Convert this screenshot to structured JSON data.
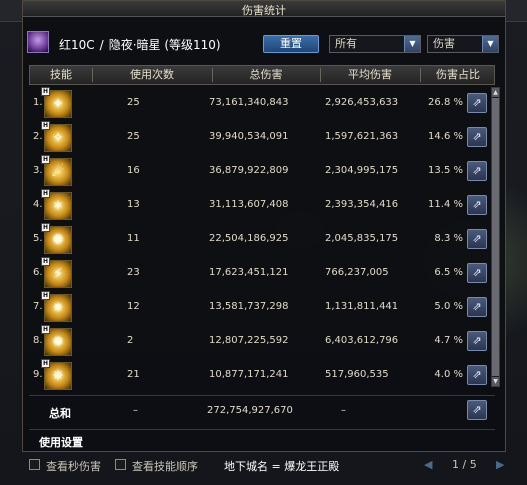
{
  "window": {
    "title": "伤害统计"
  },
  "character": {
    "name": "红10C",
    "class_level": "隐夜·暗星 (等级110)"
  },
  "controls": {
    "reset_label": "重置",
    "filter_all": "所有",
    "filter_type": "伤害"
  },
  "table": {
    "headers": [
      "技能",
      "使用次数",
      "总伤害",
      "平均伤害",
      "伤害占比"
    ],
    "rows": [
      {
        "no": "1.",
        "uses": "25",
        "total": "73,161,340,843",
        "avg": "2,926,453,633",
        "pct": "26.8 %"
      },
      {
        "no": "2.",
        "uses": "25",
        "total": "39,940,534,091",
        "avg": "1,597,621,363",
        "pct": "14.6 %"
      },
      {
        "no": "3.",
        "uses": "16",
        "total": "36,879,922,809",
        "avg": "2,304,995,175",
        "pct": "13.5 %"
      },
      {
        "no": "4.",
        "uses": "13",
        "total": "31,113,607,408",
        "avg": "2,393,354,416",
        "pct": "11.4 %"
      },
      {
        "no": "5.",
        "uses": "11",
        "total": "22,504,186,925",
        "avg": "2,045,835,175",
        "pct": "8.3 %"
      },
      {
        "no": "6.",
        "uses": "23",
        "total": "17,623,451,121",
        "avg": "766,237,005",
        "pct": "6.5 %"
      },
      {
        "no": "7.",
        "uses": "12",
        "total": "13,581,737,298",
        "avg": "1,131,811,441",
        "pct": "5.0 %"
      },
      {
        "no": "8.",
        "uses": "2",
        "total": "12,807,225,592",
        "avg": "6,403,612,796",
        "pct": "4.7 %"
      },
      {
        "no": "9.",
        "uses": "21",
        "total": "10,877,171,241",
        "avg": "517,960,535",
        "pct": "4.0 %"
      }
    ],
    "total": {
      "label": "总和",
      "uses": "–",
      "total": "272,754,927,670",
      "avg": "–"
    }
  },
  "settings": {
    "label": "使用设置"
  },
  "bottom": {
    "chk_per_sec": "查看秒伤害",
    "chk_skill_order": "查看技能顺序",
    "dungeon": "地下城名 = 爆龙王正殿",
    "page": "1 / 5"
  }
}
